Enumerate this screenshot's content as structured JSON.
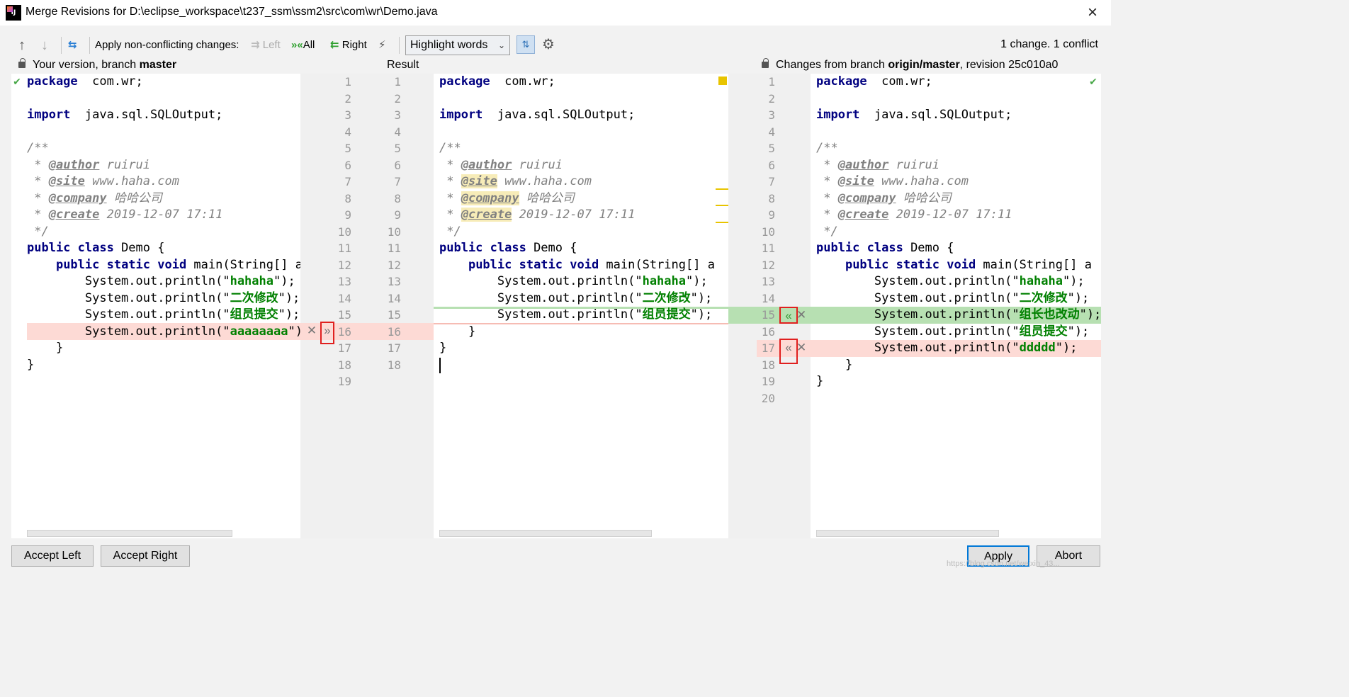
{
  "window": {
    "title": "Merge Revisions for D:\\eclipse_workspace\\t237_ssm\\ssm2\\src\\com\\wr\\Demo.java",
    "close": "×",
    "app_icon": "IJ"
  },
  "toolbar": {
    "up_arrow": "↑",
    "down_arrow": "↓",
    "apply_label": "Apply non-conflicting changes:",
    "left_label": "Left",
    "all_label": "All",
    "right_label": "Right",
    "highlight": "Highlight words",
    "sync_icon": "⇅",
    "gear": "⚙",
    "status": "1 change. 1 conflict"
  },
  "left_pane": {
    "header_prefix": "Your version, branch ",
    "header_branch": "master",
    "lines": [
      [
        [
          "kw",
          "package"
        ],
        [
          "",
          "  com.wr;"
        ]
      ],
      [],
      [
        [
          "kw",
          "import"
        ],
        [
          "",
          "  java.sql.SQLOutput;"
        ]
      ],
      [],
      [
        [
          "cmt",
          "/**"
        ]
      ],
      [
        [
          "cmt",
          " * "
        ],
        [
          "tag",
          "@author"
        ],
        [
          "cmt",
          " ruirui"
        ]
      ],
      [
        [
          "cmt",
          " * "
        ],
        [
          "tag",
          "@site"
        ],
        [
          "cmt",
          " www.haha.com"
        ]
      ],
      [
        [
          "cmt",
          " * "
        ],
        [
          "tag",
          "@company"
        ],
        [
          "cmt",
          " 哈哈公司"
        ]
      ],
      [
        [
          "cmt",
          " * "
        ],
        [
          "tag",
          "@create"
        ],
        [
          "cmt",
          " 2019-12-07 17:11"
        ]
      ],
      [
        [
          "cmt",
          " */"
        ]
      ],
      [
        [
          "kw",
          "public class"
        ],
        [
          "",
          " Demo {"
        ]
      ],
      [
        [
          "",
          "    "
        ],
        [
          "kw",
          "public static void"
        ],
        [
          "",
          " main(String[] a"
        ]
      ],
      [
        [
          "",
          "        System.out.println(\""
        ],
        [
          "str",
          "hahaha"
        ],
        [
          "",
          "\");"
        ]
      ],
      [
        [
          "",
          "        System.out.println(\""
        ],
        [
          "str",
          "二次修改"
        ],
        [
          "",
          "\");"
        ]
      ],
      [
        [
          "",
          "        System.out.println(\""
        ],
        [
          "str",
          "组员提交"
        ],
        [
          "",
          "\");"
        ]
      ],
      [
        [
          "",
          "        System.out.println(\""
        ],
        [
          "str",
          "aaaaaaaa"
        ],
        [
          "",
          "\");"
        ]
      ],
      [
        [
          "",
          "    }"
        ]
      ],
      [
        [
          "",
          "}"
        ]
      ],
      []
    ]
  },
  "result_pane": {
    "header": "Result",
    "lines": [
      [
        [
          "kw",
          "package"
        ],
        [
          "",
          "  com.wr;"
        ]
      ],
      [],
      [
        [
          "kw",
          "import"
        ],
        [
          "",
          "  java.sql.SQLOutput;"
        ]
      ],
      [],
      [
        [
          "cmt",
          "/**"
        ]
      ],
      [
        [
          "cmt",
          " * "
        ],
        [
          "tag",
          "@author"
        ],
        [
          "cmt",
          " ruirui"
        ]
      ],
      [
        [
          "cmt",
          " * "
        ],
        [
          "tag hl",
          "@site"
        ],
        [
          "cmt",
          " www.haha.com"
        ]
      ],
      [
        [
          "cmt",
          " * "
        ],
        [
          "tag hl",
          "@company"
        ],
        [
          "cmt",
          " 哈哈公司"
        ]
      ],
      [
        [
          "cmt",
          " * "
        ],
        [
          "tag hl",
          "@create"
        ],
        [
          "cmt",
          " 2019-12-07 17:11"
        ]
      ],
      [
        [
          "cmt",
          " */"
        ]
      ],
      [
        [
          "kw",
          "public class"
        ],
        [
          "",
          " Demo {"
        ]
      ],
      [
        [
          "",
          "    "
        ],
        [
          "kw",
          "public static void"
        ],
        [
          "",
          " main(String[] a"
        ]
      ],
      [
        [
          "",
          "        System.out.println(\""
        ],
        [
          "str",
          "hahaha"
        ],
        [
          "",
          "\");"
        ]
      ],
      [
        [
          "",
          "        System.out.println(\""
        ],
        [
          "str",
          "二次修改"
        ],
        [
          "",
          "\");"
        ]
      ],
      [
        [
          "",
          "        System.out.println(\""
        ],
        [
          "str",
          "组员提交"
        ],
        [
          "",
          "\");"
        ]
      ],
      [
        [
          "",
          "    }"
        ]
      ],
      [
        [
          "",
          "}"
        ]
      ],
      []
    ]
  },
  "right_pane": {
    "header_prefix": "Changes from branch ",
    "header_branch": "origin/master",
    "header_suffix": ", revision 25c010a0",
    "lines": [
      [
        [
          "kw",
          "package"
        ],
        [
          "",
          "  com.wr;"
        ]
      ],
      [],
      [
        [
          "kw",
          "import"
        ],
        [
          "",
          "  java.sql.SQLOutput;"
        ]
      ],
      [],
      [
        [
          "cmt",
          "/**"
        ]
      ],
      [
        [
          "cmt",
          " * "
        ],
        [
          "tag",
          "@author"
        ],
        [
          "cmt",
          " ruirui"
        ]
      ],
      [
        [
          "cmt",
          " * "
        ],
        [
          "tag",
          "@site"
        ],
        [
          "cmt",
          " www.haha.com"
        ]
      ],
      [
        [
          "cmt",
          " * "
        ],
        [
          "tag",
          "@company"
        ],
        [
          "cmt",
          " 哈哈公司"
        ]
      ],
      [
        [
          "cmt",
          " * "
        ],
        [
          "tag",
          "@create"
        ],
        [
          "cmt",
          " 2019-12-07 17:11"
        ]
      ],
      [
        [
          "cmt",
          " */"
        ]
      ],
      [
        [
          "kw",
          "public class"
        ],
        [
          "",
          " Demo {"
        ]
      ],
      [
        [
          "",
          "    "
        ],
        [
          "kw",
          "public static void"
        ],
        [
          "",
          " main(String[] a"
        ]
      ],
      [
        [
          "",
          "        System.out.println(\""
        ],
        [
          "str",
          "hahaha"
        ],
        [
          "",
          "\");"
        ]
      ],
      [
        [
          "",
          "        System.out.println(\""
        ],
        [
          "str",
          "二次修改"
        ],
        [
          "",
          "\");"
        ]
      ],
      [
        [
          "",
          "        System.out.println(\""
        ],
        [
          "str",
          "组长也改动"
        ],
        [
          "",
          "\");"
        ]
      ],
      [
        [
          "",
          "        System.out.println(\""
        ],
        [
          "str",
          "组员提交"
        ],
        [
          "",
          "\");"
        ]
      ],
      [
        [
          "",
          "        System.out.println(\""
        ],
        [
          "str",
          "ddddd"
        ],
        [
          "",
          "\");"
        ]
      ],
      [
        [
          "",
          "    }"
        ]
      ],
      [
        [
          "",
          "}"
        ]
      ],
      []
    ]
  },
  "gutters": {
    "left": [
      "1",
      "2",
      "3",
      "4",
      "5",
      "6",
      "7",
      "8",
      "9",
      "10",
      "11",
      "12",
      "13",
      "14",
      "15",
      "16",
      "17",
      "18",
      "19"
    ],
    "result": [
      "1",
      "2",
      "3",
      "4",
      "5",
      "6",
      "7",
      "8",
      "9",
      "10",
      "11",
      "12",
      "13",
      "14",
      "15",
      "16",
      "17",
      "18"
    ],
    "right": [
      "1",
      "2",
      "3",
      "4",
      "5",
      "6",
      "7",
      "8",
      "9",
      "10",
      "11",
      "12",
      "13",
      "14",
      "15",
      "16",
      "17",
      "18",
      "19",
      "20"
    ]
  },
  "markers": {
    "reject": "✕",
    "apply_right": "»",
    "apply_left": "«",
    "check": "✔"
  },
  "footer": {
    "accept_left": "Accept Left",
    "accept_right": "Accept Right",
    "apply": "Apply",
    "abort": "Abort"
  },
  "watermark": "https://blog.csdn.net/weixin_43..."
}
